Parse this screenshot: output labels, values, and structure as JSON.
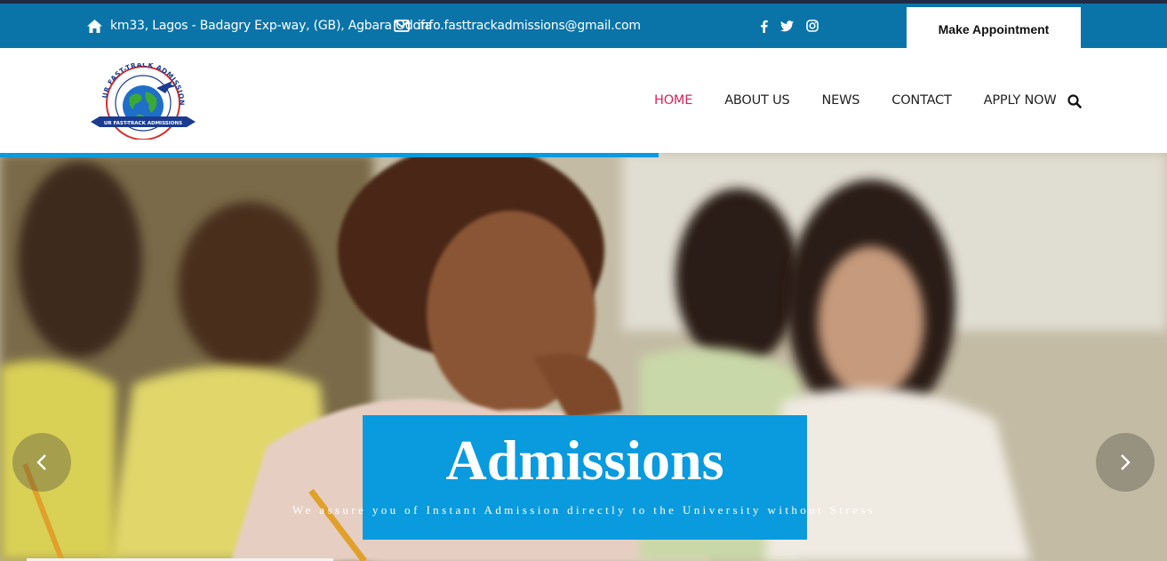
{
  "topbar": {
    "address": "km33, Lagos - Badagry Exp-way, (GB), Agbara Odofa",
    "email": "info.fasttrackadmissions@gmail.com",
    "social": [
      "facebook-icon",
      "twitter-icon",
      "instagram-icon"
    ],
    "appointment_label": "Make Appointment"
  },
  "header": {
    "logo": {
      "ring_text": "UR FAST-TRACK ADMISSIONS",
      "banner_text": "UR FAST-TRACK ADMISSIONS"
    },
    "nav": [
      "HOME",
      "ABOUT US",
      "NEWS",
      "CONTACT",
      "APPLY NOW"
    ],
    "active_nav": "HOME"
  },
  "hero": {
    "title": "Admissions",
    "subtitle": "We assure you of Instant Admission directly to the University without Stress"
  },
  "colors": {
    "topbar": "#0a74a8",
    "accent": "#0a9ade",
    "active_link": "#d6245a"
  }
}
